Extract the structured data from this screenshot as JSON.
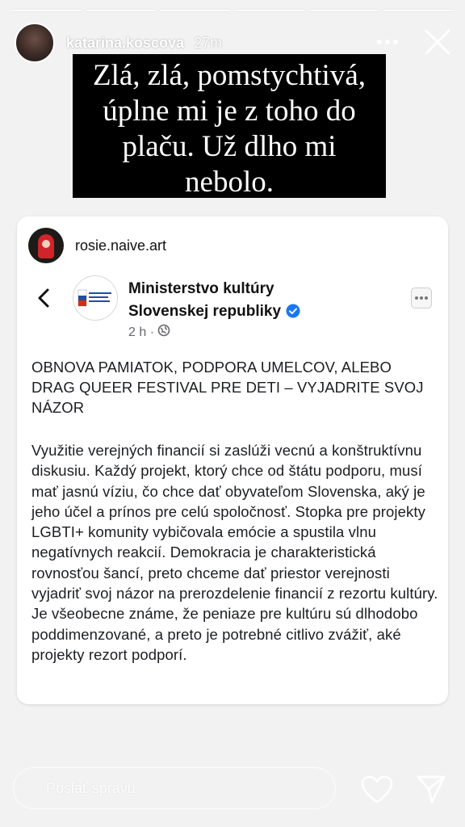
{
  "story": {
    "username": "katarina.koscova",
    "time_ago": "27m",
    "caption": "Zlá, zlá, pomstychtivá, úplne mi je z toho do plaču. Už dlho mi nebolo."
  },
  "shared_post": {
    "sharer": "rosie.naive.art",
    "page_name_line1": "Ministerstvo kultúry",
    "page_name_line2": "Slovenskej republiky",
    "post_time": "2 h ·",
    "title": "OBNOVA PAMIATOK, PODPORA UMELCOV, ALEBO DRAG QUEER FESTIVAL PRE DETI – VYJADRITE SVOJ NÁZOR",
    "body": "Využitie verejných financií si zaslúži vecnú a konštruktívnu diskusiu. Každý projekt, ktorý chce od štátu podporu, musí mať jasnú víziu, čo chce dať obyvateľom Slovenska, aký je jeho účel a prínos pre celú spoločnosť. Stopka pre projekty LGBTI+ komunity vybičovala emócie a spustila vlnu negatívnych reakcií. Demokracia je charakteristická rovnosťou šancí, preto chceme dať priestor verejnosti vyjadriť svoj názor na prerozdelenie financií z rezortu kultúry. Je všeobecne známe, že peniaze pre kultúru sú dlhodobo poddimenzované, a preto je potrebné citlivo zvážiť, aké projekty rezort podporí."
  },
  "footer": {
    "message_placeholder": "Poslať správu"
  },
  "colors": {
    "verified_blue": "#1877f2",
    "caption_bg": "#000000",
    "card_bg": "#ffffff"
  },
  "icons": [
    "more-icon",
    "close-icon",
    "back-chevron-icon",
    "verified-badge-icon",
    "globe-icon",
    "heart-icon",
    "send-icon"
  ]
}
